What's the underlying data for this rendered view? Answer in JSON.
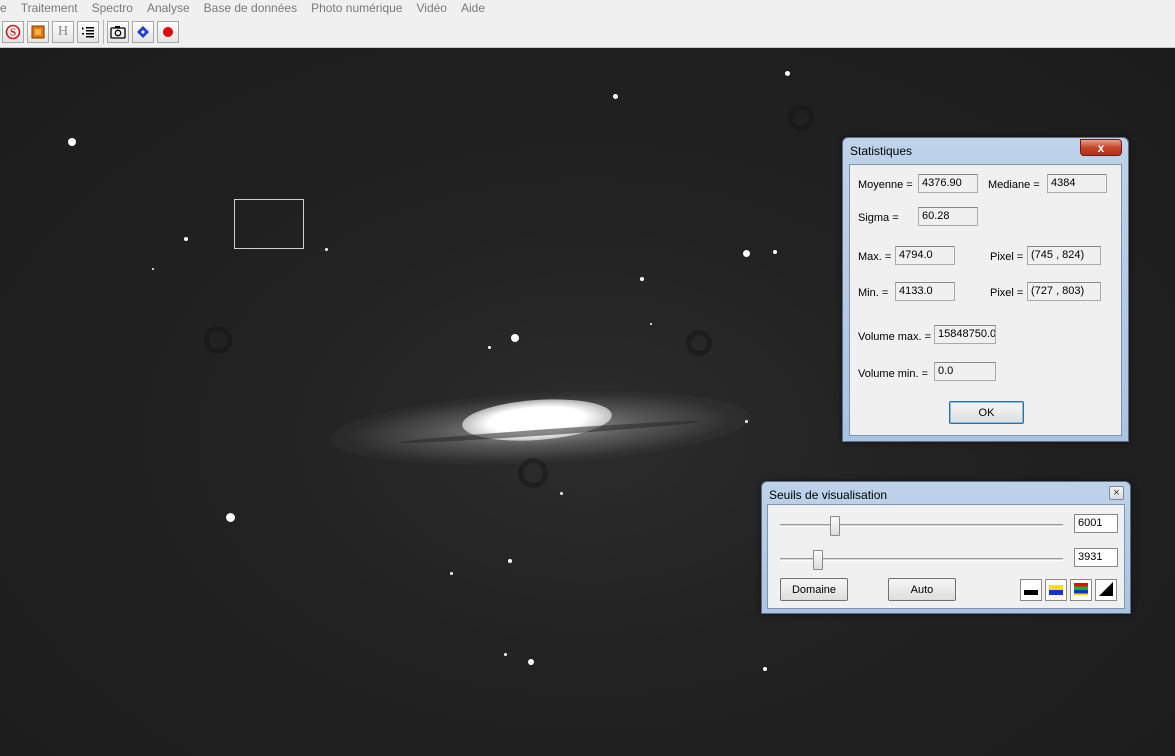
{
  "menu": [
    "e",
    "Traitement",
    "Spectro",
    "Analyse",
    "Base de données",
    "Photo numérique",
    "Vidéo",
    "Aide"
  ],
  "toolbar": {
    "icons": [
      "spectro-s-icon",
      "image-frame-icon",
      "h-header-icon",
      "list-icon",
      "camera-icon",
      "diamond-icon",
      "record-icon"
    ],
    "h_label": "H"
  },
  "stats": {
    "title": "Statistiques",
    "close_label": "x",
    "moyenne_label": "Moyenne =",
    "moyenne_value": "4376.90",
    "mediane_label": "Mediane =",
    "mediane_value": "4384",
    "sigma_label": "Sigma =",
    "sigma_value": "60.28",
    "max_label": "Max. =",
    "max_value": "4794.0",
    "max_pixel_label": "Pixel =",
    "max_pixel_value": "(745 , 824)",
    "min_label": "Min. =",
    "min_value": "4133.0",
    "min_pixel_label": "Pixel =",
    "min_pixel_value": "(727 , 803)",
    "volmax_label": "Volume max. =",
    "volmax_value": "15848750.0",
    "volmin_label": "Volume min. =",
    "volmin_value": "0.0",
    "ok_label": "OK"
  },
  "seuils": {
    "title": "Seuils de visualisation",
    "close_label": "×",
    "high_value": "6001",
    "low_value": "3931",
    "domaine_label": "Domaine",
    "auto_label": "Auto",
    "palette_icons": [
      "palette-bw-icon",
      "palette-blue-yellow-icon",
      "palette-rainbow-icon",
      "palette-gradient-icon"
    ]
  }
}
